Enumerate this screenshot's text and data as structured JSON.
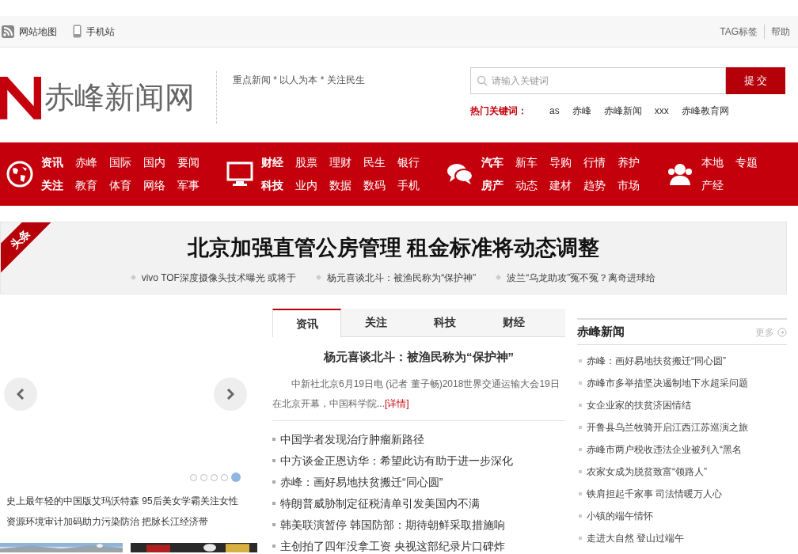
{
  "top_bar": {
    "left_links": [
      "网站地图",
      "手机站"
    ],
    "right_links": [
      "TAG标签",
      "帮助"
    ]
  },
  "header": {
    "logo_text": "赤峰新闻网",
    "slogan": "重点新闻 * 以人为本 * 关注民生",
    "search": {
      "placeholder": "请输入关键词",
      "button": "提 交"
    },
    "hot_label": "热门关键词：",
    "hot_keywords": [
      "as",
      "赤峰",
      "赤峰新闻",
      "xxx",
      "赤峰教育网"
    ]
  },
  "nav": {
    "groups": [
      {
        "rows": [
          [
            {
              "label": "资讯",
              "bold": true
            },
            {
              "label": "赤峰",
              "bold": false
            },
            {
              "label": "国际",
              "bold": false
            },
            {
              "label": "国内",
              "bold": false
            },
            {
              "label": "要闻",
              "bold": false
            }
          ],
          [
            {
              "label": "关注",
              "bold": true
            },
            {
              "label": "教育",
              "bold": false
            },
            {
              "label": "体育",
              "bold": false
            },
            {
              "label": "网络",
              "bold": false
            },
            {
              "label": "军事",
              "bold": false
            }
          ]
        ]
      },
      {
        "rows": [
          [
            {
              "label": "财经",
              "bold": true
            },
            {
              "label": "股票",
              "bold": false
            },
            {
              "label": "理财",
              "bold": false
            },
            {
              "label": "民生",
              "bold": false
            },
            {
              "label": "银行",
              "bold": false
            }
          ],
          [
            {
              "label": "科技",
              "bold": true
            },
            {
              "label": "业内",
              "bold": false
            },
            {
              "label": "数据",
              "bold": false
            },
            {
              "label": "数码",
              "bold": false
            },
            {
              "label": "手机",
              "bold": false
            }
          ]
        ]
      },
      {
        "rows": [
          [
            {
              "label": "汽车",
              "bold": true
            },
            {
              "label": "新车",
              "bold": false
            },
            {
              "label": "导购",
              "bold": false
            },
            {
              "label": "行情",
              "bold": false
            },
            {
              "label": "养护",
              "bold": false
            }
          ],
          [
            {
              "label": "房产",
              "bold": true
            },
            {
              "label": "动态",
              "bold": false
            },
            {
              "label": "建材",
              "bold": false
            },
            {
              "label": "趋势",
              "bold": false
            },
            {
              "label": "市场",
              "bold": false
            }
          ]
        ]
      },
      {
        "rows": [
          [
            {
              "label": "本地",
              "bold": false
            },
            {
              "label": "专题",
              "bold": false
            }
          ],
          [
            {
              "label": "产经",
              "bold": false
            }
          ]
        ]
      }
    ]
  },
  "headline": {
    "ribbon": "头条",
    "title": "北京加强直管公房管理 租金标准将动态调整",
    "links": [
      "vivo  TOF深度摄像头技术曝光 或将于",
      "杨元喜谈北斗：被渔民称为“保护神”",
      "波兰“乌龙助攻”冤不冤？离奇进球给"
    ]
  },
  "carousel": {
    "dots": [
      {
        "selected": false
      },
      {
        "selected": false
      },
      {
        "selected": false
      },
      {
        "selected": false
      },
      {
        "selected": true
      }
    ],
    "links": [
      "史上最年轻的中国版艾玛沃特森 95后美女学霸关注女性",
      "资源环境审计加码助力污染防治 把脉长江经济带"
    ]
  },
  "tabs": [
    {
      "label": "资讯",
      "selected": true
    },
    {
      "label": "关注",
      "selected": false
    },
    {
      "label": "科技",
      "selected": false
    },
    {
      "label": "财经",
      "selected": false
    }
  ],
  "feature": {
    "title": "杨元喜谈北斗：被渔民称为“保护神”",
    "summary": "中新社北京6月19日电 (记者 董子畅)2018世界交通运输大会19日在北京开幕，中国科学院...",
    "more": "[详情]"
  },
  "news_list": [
    "中国学者发现治疗肿瘤新路径",
    "中方谈金正恩访华：希望此访有助于进一步深化",
    "赤峰：画好易地扶贫搬迁“同心圆”",
    "特朗普威胁制定征税清单引发美国内不满",
    "韩美联演暂停 韩国防部：期待朝鲜采取措施响",
    "主创拍了四年没拿工资 央视这部纪录片口碑炸"
  ],
  "local_news": {
    "title": "赤峰新闻",
    "more": "更多",
    "items": [
      "赤峰：画好易地扶贫搬迁“同心圆”",
      "赤峰市多举措坚决遏制地下水超采问题",
      "女企业家的扶贫济困情结",
      "开鲁县乌兰牧骑开启江西江苏巡演之旅",
      "赤峰市两户税收违法企业被列入“黑名",
      "农家女成为脱贫致富“领路人”",
      "铁肩担起千家事 司法情暖万人心",
      "小镇的端午情怀",
      "走进大自然 登山过端午"
    ]
  }
}
